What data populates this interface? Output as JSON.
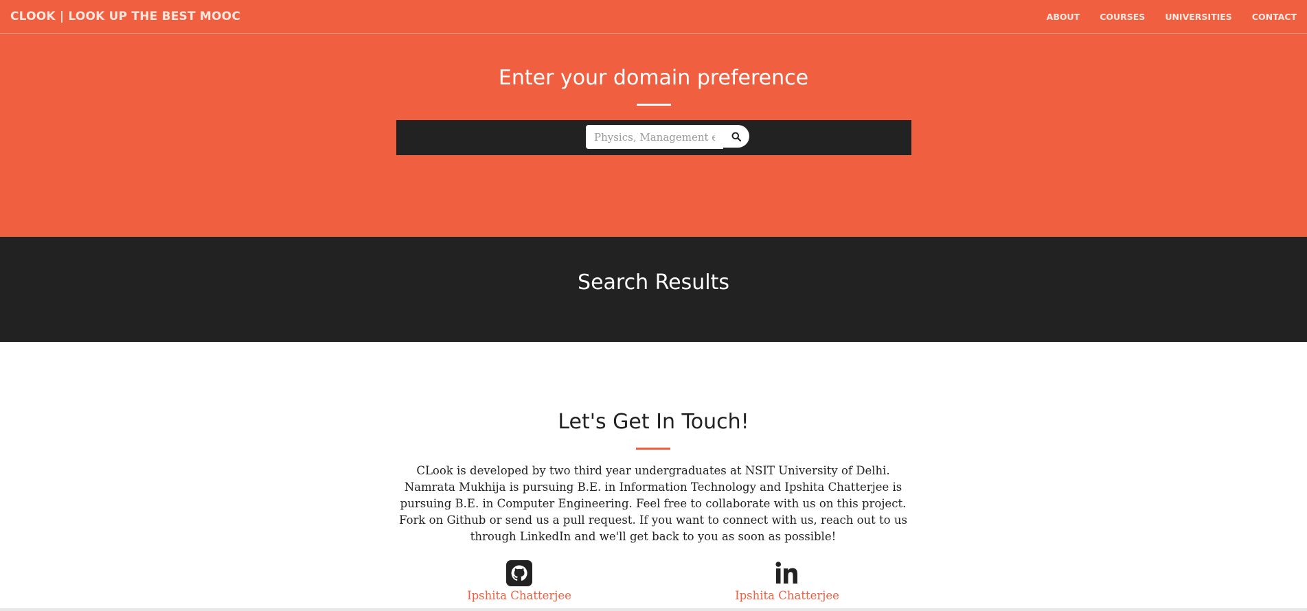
{
  "navbar": {
    "brand": "CLOOK | LOOK UP THE BEST MOOC",
    "links": [
      "ABOUT",
      "COURSES",
      "UNIVERSITIES",
      "CONTACT"
    ]
  },
  "hero": {
    "title": "Enter your domain preference",
    "search": {
      "placeholder": "Physics, Management etc",
      "value": ""
    }
  },
  "results": {
    "title": "Search Results"
  },
  "contact": {
    "title": "Let's Get In Touch!",
    "text": "CLook is developed by two third year undergraduates at NSIT University of Delhi. Namrata Mukhija is pursuing B.E. in Information Technology and Ipshita Chatterjee is pursuing B.E. in Computer Engineering. Feel free to collaborate with us on this project. Fork on Github or send us a pull request. If you want to connect with us, reach out to us through LinkedIn and we'll get back to you as soon as possible!",
    "github": {
      "icon": "github-icon",
      "label": "Ipshita Chatterjee"
    },
    "linkedin": {
      "icon": "linkedin-icon",
      "label": "Ipshita Chatterjee"
    }
  },
  "colors": {
    "primary": "#f05f40",
    "dark": "#222222",
    "white": "#ffffff"
  }
}
